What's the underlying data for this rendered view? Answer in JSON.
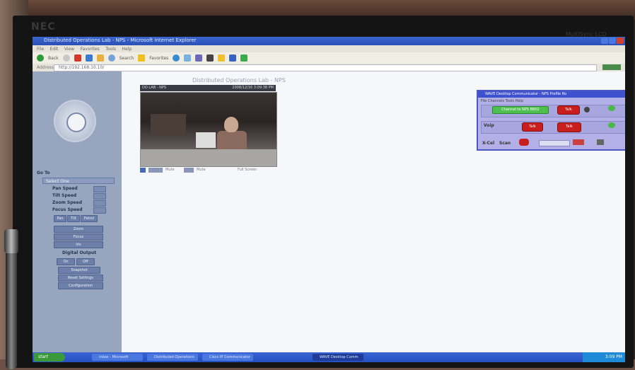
{
  "monitor": {
    "brand": "NEC",
    "model": "MultiSync LCD"
  },
  "browser": {
    "title": "Distributed Operations Lab - NPS - Microsoft Internet Explorer",
    "menu": [
      "File",
      "Edit",
      "View",
      "Favorites",
      "Tools",
      "Help"
    ],
    "toolbar": [
      "Back",
      "Search",
      "Favorites"
    ],
    "address_label": "Address",
    "address": "http://192.168.10.10/"
  },
  "left_panel": {
    "goto_label": "Go To",
    "select_value": "Select One",
    "speeds": [
      "Pan Speed",
      "Tilt Speed",
      "Zoom Speed",
      "Focus Speed"
    ],
    "buttons_row1": [
      "Pan",
      "Tilt",
      "Patrol"
    ],
    "zoom": "Zoom",
    "focus": "Focus",
    "iris": "Iris",
    "digital_output": "Digital Output",
    "on": "On",
    "off": "Off",
    "snapshot": "Snapshot",
    "reset_settings": "Reset Settings",
    "configuration": "Configuration"
  },
  "content": {
    "heading": "Distributed Operations Lab - NPS",
    "camera_label": "DO LAB - NPS",
    "camera_timestamp": "2008/12/16 3:09:38 PM",
    "ctl_mute": "Mute",
    "ctl_mute2": "Mute",
    "ctl_fullscreen": "Full Screen"
  },
  "communicator": {
    "title": "WAVE Desktop Communicator - NPS Profile Ro",
    "menu": "File  Channels  Tools  Help",
    "channel": "Channel to NPS BB02",
    "talk": "Talk",
    "talk2": "Talk",
    "talk3": "Talk",
    "row2_label": "Voip",
    "row3_label": "X-Cel",
    "scan": "Scan"
  },
  "taskbar": {
    "start": "start",
    "items": [
      "Inbox - Microsoft Outlook",
      "Distributed Operations",
      "Cisco IP Communicator",
      "WAVE Desktop Comm"
    ],
    "clock": "3:09 PM"
  }
}
